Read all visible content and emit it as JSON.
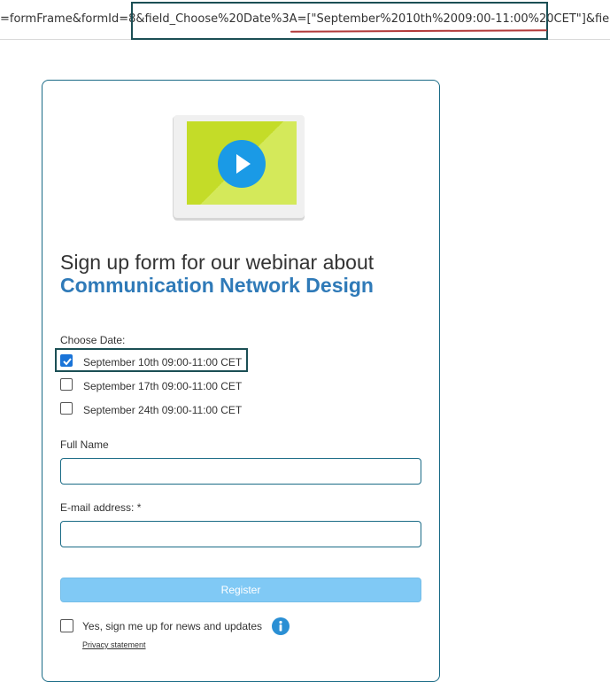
{
  "browser": {
    "url_text": "=formFrame&formId=8&field_Choose%20Date%3A=[\"September%2010th%2009:00-11:00%20CET\"]&field_Full%"
  },
  "form": {
    "title_line1": "Sign up form for our webinar about",
    "title_line2": "Communication Network Design",
    "choose_date_label": "Choose Date:",
    "date_options": [
      {
        "label": "September 10th 09:00-11:00 CET",
        "checked": true
      },
      {
        "label": "September 17th 09:00-11:00 CET",
        "checked": false
      },
      {
        "label": "September 24th 09:00-11:00 CET",
        "checked": false
      }
    ],
    "full_name_label": "Full Name",
    "full_name_value": "",
    "email_label": "E-mail address: *",
    "email_value": "",
    "register_label": "Register",
    "newsletter_label": "Yes, sign me up for news and updates",
    "newsletter_checked": false,
    "privacy_label": "Privacy statement"
  },
  "colors": {
    "accent_blue": "#2f7ab8",
    "register_bg": "#80c9f5",
    "checkbox_checked": "#1a74d8",
    "annotation_box": "#1b4f55",
    "annotation_underline": "#b23a3a",
    "thumbnail_green": "#c4dc28",
    "play_blue": "#1a9ae6"
  },
  "icons": {
    "video": "play-icon",
    "info": "info-icon",
    "check": "checkmark-icon"
  }
}
